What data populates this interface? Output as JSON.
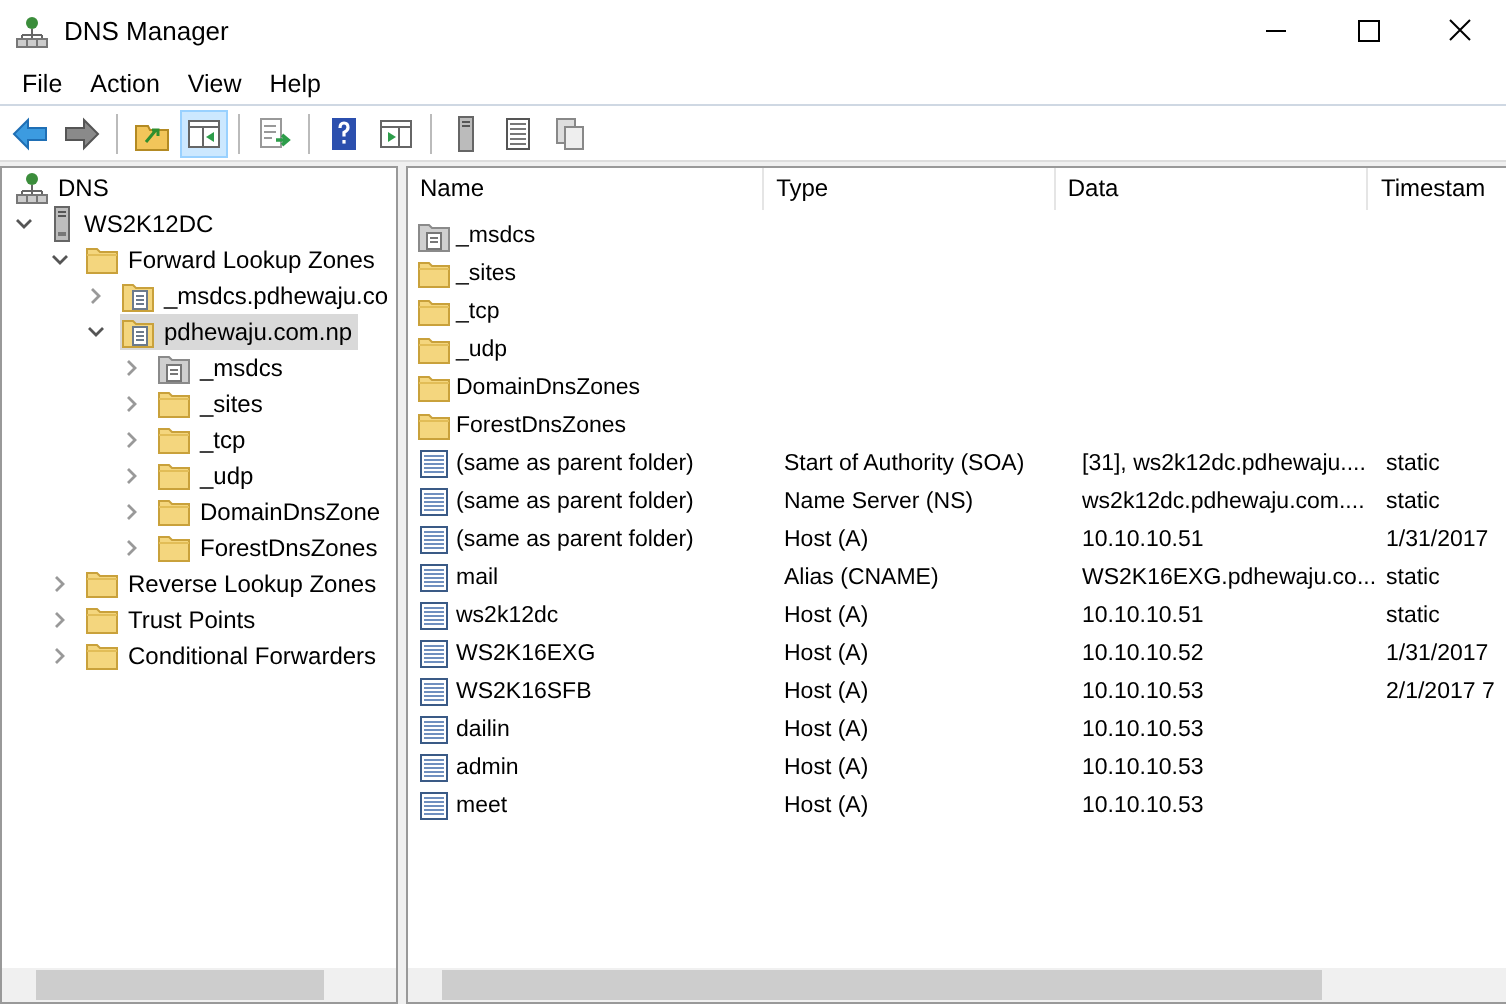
{
  "window": {
    "title": "DNS Manager"
  },
  "menu": [
    "File",
    "Action",
    "View",
    "Help"
  ],
  "toolbar": [
    {
      "kind": "back",
      "pressed": false
    },
    {
      "kind": "forward",
      "pressed": false
    },
    {
      "kind": "sep"
    },
    {
      "kind": "up-folder",
      "pressed": false
    },
    {
      "kind": "console-tree",
      "pressed": true
    },
    {
      "kind": "sep"
    },
    {
      "kind": "export",
      "pressed": false
    },
    {
      "kind": "sep"
    },
    {
      "kind": "help",
      "pressed": false
    },
    {
      "kind": "action-pane",
      "pressed": false
    },
    {
      "kind": "sep"
    },
    {
      "kind": "server",
      "pressed": false
    },
    {
      "kind": "record",
      "pressed": false
    },
    {
      "kind": "copy",
      "pressed": false
    }
  ],
  "tree": [
    {
      "label": "DNS",
      "kind": "dns",
      "selected": false,
      "children": [
        {
          "label": "WS2K12DC",
          "kind": "server",
          "expanded": true,
          "selected": false,
          "children": [
            {
              "label": "Forward Lookup Zones",
              "kind": "folder",
              "expanded": true,
              "selected": false,
              "children": [
                {
                  "label": "_msdcs.pdhewaju.co",
                  "kind": "zone",
                  "expanded": false,
                  "selected": false
                },
                {
                  "label": "pdhewaju.com.np",
                  "kind": "zone",
                  "expanded": true,
                  "selected": true,
                  "children": [
                    {
                      "label": "_msdcs",
                      "kind": "delegation",
                      "expanded": false,
                      "selected": false
                    },
                    {
                      "label": "_sites",
                      "kind": "folder",
                      "expanded": false,
                      "selected": false
                    },
                    {
                      "label": "_tcp",
                      "kind": "folder",
                      "expanded": false,
                      "selected": false
                    },
                    {
                      "label": "_udp",
                      "kind": "folder",
                      "expanded": false,
                      "selected": false
                    },
                    {
                      "label": "DomainDnsZone",
                      "kind": "folder",
                      "expanded": false,
                      "selected": false
                    },
                    {
                      "label": "ForestDnsZones",
                      "kind": "folder",
                      "expanded": false,
                      "selected": false
                    }
                  ]
                }
              ]
            },
            {
              "label": "Reverse Lookup Zones",
              "kind": "folder",
              "expanded": false,
              "selected": false
            },
            {
              "label": "Trust Points",
              "kind": "folder",
              "expanded": false,
              "selected": false
            },
            {
              "label": "Conditional Forwarders",
              "kind": "folder",
              "expanded": false,
              "selected": false
            }
          ]
        }
      ]
    }
  ],
  "table": {
    "columns": [
      "Name",
      "Type",
      "Data",
      "Timestam"
    ],
    "rows": [
      {
        "kind": "delegation",
        "name": "_msdcs"
      },
      {
        "kind": "folder",
        "name": "_sites"
      },
      {
        "kind": "folder",
        "name": "_tcp"
      },
      {
        "kind": "folder",
        "name": "_udp"
      },
      {
        "kind": "folder",
        "name": "DomainDnsZones"
      },
      {
        "kind": "folder",
        "name": "ForestDnsZones"
      },
      {
        "kind": "record",
        "name": "(same as parent folder)",
        "type": "Start of Authority (SOA)",
        "data": "[31], ws2k12dc.pdhewaju....",
        "timestamp": "static"
      },
      {
        "kind": "record",
        "name": "(same as parent folder)",
        "type": "Name Server (NS)",
        "data": "ws2k12dc.pdhewaju.com....",
        "timestamp": "static"
      },
      {
        "kind": "record",
        "name": "(same as parent folder)",
        "type": "Host (A)",
        "data": "10.10.10.51",
        "timestamp": "1/31/2017"
      },
      {
        "kind": "record",
        "name": "mail",
        "type": "Alias (CNAME)",
        "data": "WS2K16EXG.pdhewaju.co...",
        "timestamp": "static"
      },
      {
        "kind": "record",
        "name": "ws2k12dc",
        "type": "Host (A)",
        "data": "10.10.10.51",
        "timestamp": "static"
      },
      {
        "kind": "record",
        "name": "WS2K16EXG",
        "type": "Host (A)",
        "data": "10.10.10.52",
        "timestamp": "1/31/2017"
      },
      {
        "kind": "record",
        "name": "WS2K16SFB",
        "type": "Host (A)",
        "data": "10.10.10.53",
        "timestamp": "2/1/2017 7"
      },
      {
        "kind": "record",
        "name": "dailin",
        "type": "Host (A)",
        "data": "10.10.10.53"
      },
      {
        "kind": "record",
        "name": "admin",
        "type": "Host (A)",
        "data": "10.10.10.53"
      },
      {
        "kind": "record",
        "name": "meet",
        "type": "Host (A)",
        "data": "10.10.10.53"
      }
    ]
  }
}
